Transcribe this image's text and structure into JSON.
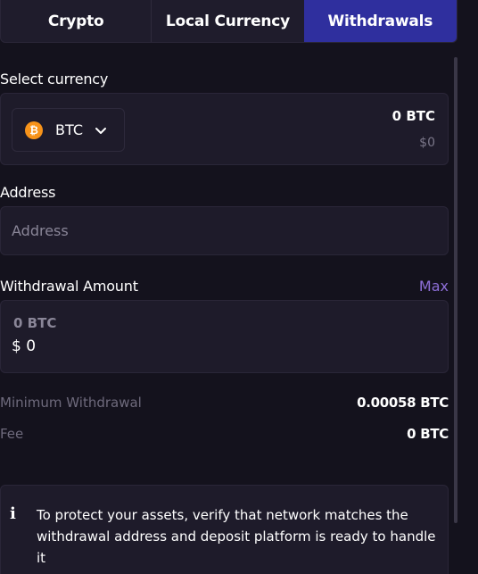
{
  "tabs": {
    "crypto": "Crypto",
    "local_currency": "Local Currency",
    "withdrawals": "Withdrawals",
    "active": "Withdrawals"
  },
  "currency": {
    "label": "Select currency",
    "selected": "BTC",
    "icon": "bitcoin-icon",
    "balance_crypto": "0 BTC",
    "balance_usd": "$0"
  },
  "address": {
    "label": "Address",
    "placeholder": "Address",
    "value": ""
  },
  "amount": {
    "label": "Withdrawal Amount",
    "max_label": "Max",
    "crypto_value": "0 BTC",
    "usd_value": "$ 0"
  },
  "details": {
    "min_label": "Minimum Withdrawal",
    "min_value": "0.00058 BTC",
    "fee_label": "Fee",
    "fee_value": "0 BTC"
  },
  "notice": {
    "icon": "info-icon",
    "text": "To protect your assets, verify that network matches the withdrawal address and deposit platform is ready to handle it"
  },
  "colors": {
    "background": "#14121d",
    "card": "#1e1b2a",
    "active_tab": "#2f2f9e",
    "accent": "#8e6fd8",
    "btc_orange": "#f7931a"
  }
}
